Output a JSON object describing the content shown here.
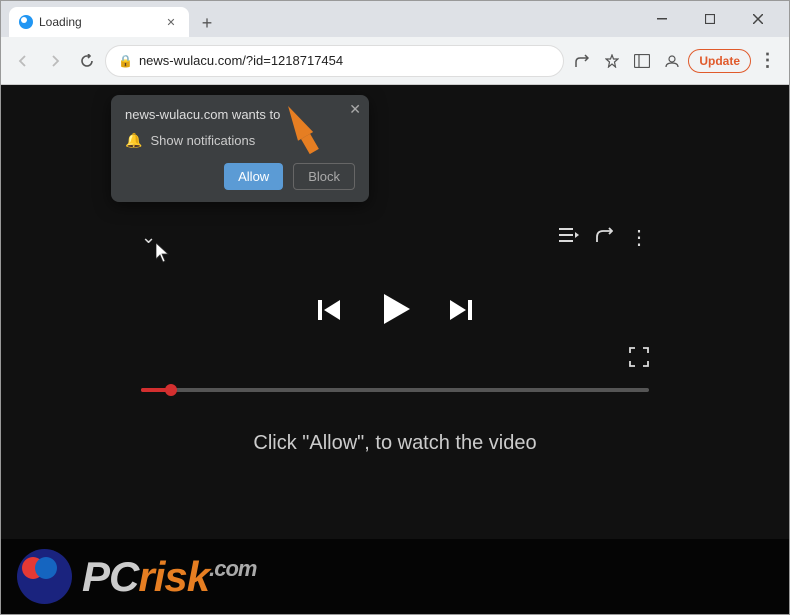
{
  "browser": {
    "title": "Loading",
    "tab": {
      "label": "Loading",
      "favicon": "page-icon"
    },
    "new_tab_label": "+",
    "window_controls": {
      "minimize": "—",
      "maximize": "□",
      "close": "✕",
      "settings": "⋯"
    },
    "address_bar": {
      "url": "news-wulacu.com/?id=1218717454",
      "lock_icon": "🔒",
      "back_label": "←",
      "forward_label": "→",
      "refresh_label": "↻",
      "share_label": "↗",
      "bookmark_label": "☆",
      "sidebar_label": "▭",
      "profile_label": "👤",
      "update_label": "Update",
      "menu_label": "⋮"
    }
  },
  "notification_popup": {
    "header": "news-wulacu.com wants to",
    "row_text": "Show notifications",
    "bell_icon": "🔔",
    "close_icon": "✕",
    "allow_label": "Allow",
    "block_label": "Block"
  },
  "player": {
    "chevron_icon": "⌄",
    "queue_icon": "≡",
    "share_icon": "↗",
    "more_icon": "⋮",
    "prev_icon": "⏮",
    "play_icon": "▶",
    "next_icon": "⏭",
    "fullscreen_icon": "⛶",
    "click_text": "Click \"Allow\", to watch the video",
    "progress_percent": 6
  },
  "watermark": {
    "logo_text_pc": "PC",
    "logo_text_risk": "risk",
    "logo_text_com": ".com"
  },
  "colors": {
    "accent_orange": "#e05a2b",
    "progress_red": "#d32f2f",
    "allow_blue": "#5b9bd5",
    "bg_dark": "#111111"
  }
}
